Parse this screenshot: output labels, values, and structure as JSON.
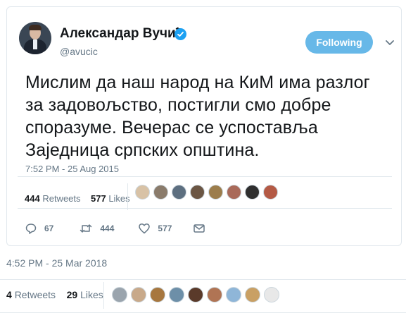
{
  "embedded_tweet": {
    "author": {
      "display_name": "Александар Вучић",
      "handle": "@avucic",
      "verified": true
    },
    "follow_button_label": "Following",
    "caret_icon": "chevron-down-icon",
    "text_lines": [
      "Мислим да наш народ на КиМ има разлог",
      "за задовољство, постигли смо добре",
      "споразуме. Вечерас се успоставља",
      "Заједница српских општина."
    ],
    "timestamp": "7:52 PM - 25 Aug 2015",
    "retweets_count": "444",
    "retweets_label": "Retweets",
    "likes_count": "577",
    "likes_label": "Likes",
    "liker_avatar_colors": [
      "#d8c2a6",
      "#8a7b6b",
      "#5d6f80",
      "#6b5644",
      "#9c7d4c",
      "#a96a5a",
      "#2f2f2f",
      "#b45a45"
    ],
    "actions": {
      "reply": {
        "icon": "reply-icon",
        "count": "67"
      },
      "retweet": {
        "icon": "retweet-icon",
        "count": "444"
      },
      "like": {
        "icon": "heart-icon",
        "count": "577"
      },
      "message": {
        "icon": "envelope-icon"
      }
    }
  },
  "outer": {
    "timestamp": "4:52 PM - 25 Mar 2018",
    "retweets_count": "4",
    "retweets_label": "Retweets",
    "likes_count": "29",
    "likes_label": "Likes",
    "liker_avatar_colors": [
      "#9aa4ad",
      "#c8a98a",
      "#a7773f",
      "#6d8fa8",
      "#5a3a2a",
      "#b07454",
      "#8fb6d8",
      "#c9a064",
      "#e8e8e8"
    ]
  },
  "colors": {
    "accent": "#1da1f2",
    "follow_button_bg": "#67b8e8",
    "muted_text": "#657786",
    "border": "#e1e8ed"
  }
}
